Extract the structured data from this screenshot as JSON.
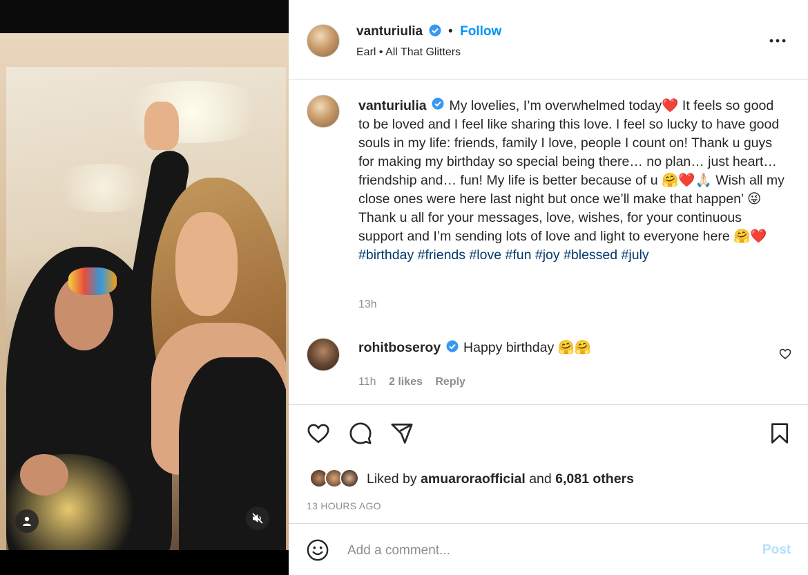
{
  "post": {
    "author": "vanturiulia",
    "follow_label": "Follow",
    "header_separator": "•",
    "audio": "Earl • All That Glitters",
    "more_label": "•••"
  },
  "caption": {
    "author": "vanturiulia",
    "text_parts": [
      "My lovelies, I’m overwhelmed today❤️  It feels so good to be loved and I feel like sharing this love. I feel so lucky to have good souls in my life: friends, family I love, people I count on! Thank u guys for making my birthday so special being there… no plan… just heart… friendship and… fun! My life is better because of u 🤗❤️🙏🏻  Wish all my close ones were here last night but once we’ll make that happen’ 😜 Thank u all for your messages, love, wishes, for your continuous support and I’m sending lots of love and light to everyone here 🤗❤️ "
    ],
    "hashtags": [
      "#birthday",
      "#friends",
      "#love",
      "#fun",
      "#joy",
      "#blessed",
      "#july"
    ],
    "time": "13h"
  },
  "comment": {
    "author": "rohitboseroy",
    "text": "Happy birthday 🤗🤗",
    "time": "11h",
    "likes": "2 likes",
    "reply_label": "Reply"
  },
  "likes": {
    "prefix": "Liked by",
    "first_liker": "amuaroraofficial",
    "and": "and",
    "others": "6,081 others"
  },
  "timestamp": "13 HOURS AGO",
  "add_comment": {
    "placeholder": "Add a comment...",
    "post_label": "Post"
  },
  "colors": {
    "accent": "#0095f6",
    "hashtag": "#00376b",
    "muted": "#8e8e8e",
    "post_disabled": "#b2dffc",
    "verified": "#3897f0"
  },
  "icons": {
    "like": "heart-icon",
    "comment": "comment-icon",
    "share": "paper-plane-icon",
    "save": "bookmark-icon",
    "emoji": "smiley-icon",
    "comment_like": "small-heart-icon",
    "user_tag": "person-icon",
    "mute": "speaker-muted-icon",
    "verified": "verified-badge-icon"
  }
}
